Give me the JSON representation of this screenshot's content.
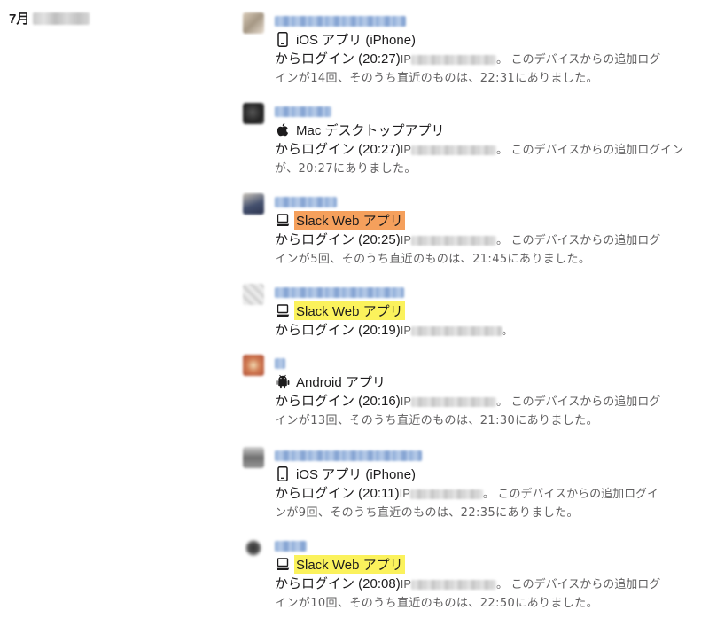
{
  "date_header": {
    "label": "7月"
  },
  "entries": [
    {
      "app": "iOS アプリ (iPhone)",
      "icon": "phone-icon",
      "highlight": "none",
      "login": "からログイン (20:27)",
      "ip_label": "IP",
      "suffix": "。 このデバイスからの追加ログ",
      "detail": "インが14回、そのうち直近のものは、22:31にありました。"
    },
    {
      "app": "Mac デスクトップアプリ",
      "icon": "apple-icon",
      "highlight": "none",
      "login": "からログイン (20:27)",
      "ip_label": "IP",
      "suffix": "。 このデバイスからの追加ログイン",
      "detail": "が、20:27にありました。"
    },
    {
      "app": "Slack Web アプリ",
      "icon": "laptop-icon",
      "highlight": "#f5a05c",
      "login": "からログイン (20:25)",
      "ip_label": "IP",
      "suffix": "。 このデバイスからの追加ログ",
      "detail": "インが5回、そのうち直近のものは、21:45にありました。"
    },
    {
      "app": "Slack Web アプリ",
      "icon": "laptop-icon",
      "highlight": "#fbf25c",
      "login": "からログイン (20:19)",
      "ip_label": "IP",
      "suffix": "。",
      "detail": ""
    },
    {
      "app": "Android アプリ",
      "icon": "android-icon",
      "highlight": "none",
      "login": "からログイン (20:16)",
      "ip_label": "IP",
      "suffix": "。 このデバイスからの追加ログ",
      "detail": "インが13回、そのうち直近のものは、21:30にありました。"
    },
    {
      "app": "iOS アプリ (iPhone)",
      "icon": "phone-icon",
      "highlight": "none",
      "login": "からログイン (20:11)",
      "ip_label": "IP",
      "suffix": "。 このデバイスからの追加ログイ",
      "detail": "ンが9回、そのうち直近のものは、22:35にありました。"
    },
    {
      "app": "Slack Web アプリ",
      "icon": "laptop-icon",
      "highlight": "#fbf25c",
      "login": "からログイン (20:08)",
      "ip_label": "IP",
      "suffix": "。 このデバイスからの追加ログ",
      "detail": "インが10回、そのうち直近のものは、22:50にありました。"
    }
  ]
}
